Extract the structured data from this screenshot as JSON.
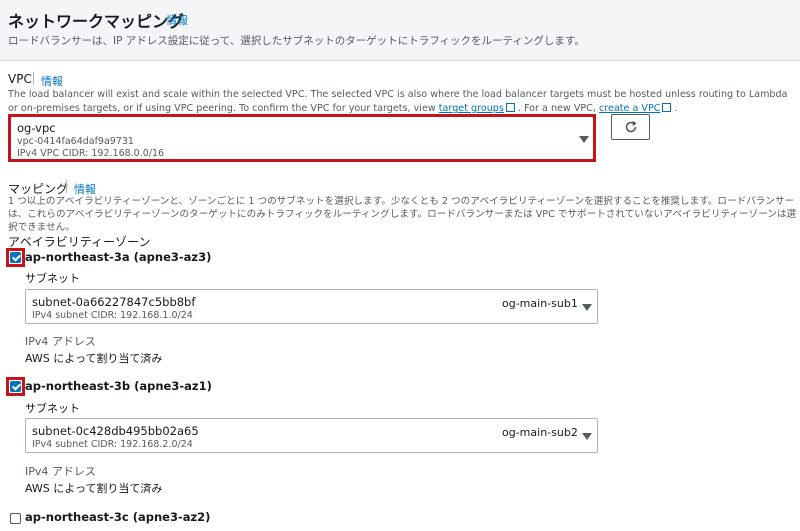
{
  "header": {
    "title": "ネットワークマッピング",
    "info": "情報",
    "description": "ロードバランサーは、IP アドレス設定に従って、選択したサブネットのターゲットにトラフィックをルーティングします。"
  },
  "vpc": {
    "label": "VPC",
    "info": "情報",
    "help_text": "The load balancer will exist and scale within the selected VPC. The selected VPC is also where the load balancer targets must be hosted unless routing to Lambda or on-premises targets, or if using VPC peering. To confirm the VPC for your targets, view",
    "target_groups_link": "target groups",
    "new_vpc_text": ". For a new VPC,",
    "create_vpc_link": "create a VPC",
    "period": ".",
    "selected_name": "og-vpc",
    "selected_id": "vpc-0414fa64daf9a9731",
    "selected_cidr": "IPv4 VPC CIDR: 192.168.0.0/16"
  },
  "mapping": {
    "label": "マッピング",
    "info": "情報",
    "help_text": "1 つ以上のアベイラビリティーゾーンと、ゾーンごとに 1 つのサブネットを選択します。少なくとも 2 つのアベイラビリティーゾーンを選択することを推奨します。ロードバランサーは、これらのアベイラビリティーゾーンのターゲットにのみトラフィックをルーティングします。ロードバランサーまたは VPC でサポートされていないアベイラビリティーゾーンは選択できません。",
    "az_heading": "アベイラビリティーゾーン",
    "zones": [
      {
        "name": "ap-northeast-3a (apne3-az3)",
        "checked": true,
        "subnet_label": "サブネット",
        "subnet_id": "subnet-0a66227847c5bb8bf",
        "subnet_cidr": "IPv4 subnet CIDR: 192.168.1.0/24",
        "subnet_name": "og-main-sub1",
        "ipv4_label": "IPv4 アドレス",
        "ipv4_value": "AWS によって割り当て済み"
      },
      {
        "name": "ap-northeast-3b (apne3-az1)",
        "checked": true,
        "subnet_label": "サブネット",
        "subnet_id": "subnet-0c428db495bb02a65",
        "subnet_cidr": "IPv4 subnet CIDR: 192.168.2.0/24",
        "subnet_name": "og-main-sub2",
        "ipv4_label": "IPv4 アドレス",
        "ipv4_value": "AWS によって割り当て済み"
      },
      {
        "name": "ap-northeast-3c (apne3-az2)",
        "checked": false
      }
    ]
  },
  "colors": {
    "link": "#0073bb",
    "highlight": "#c7141a",
    "checkbox": "#0073bb"
  },
  "icons": [
    "external-link-icon",
    "refresh-icon",
    "chevron-down-icon",
    "checkbox-checked-icon"
  ]
}
